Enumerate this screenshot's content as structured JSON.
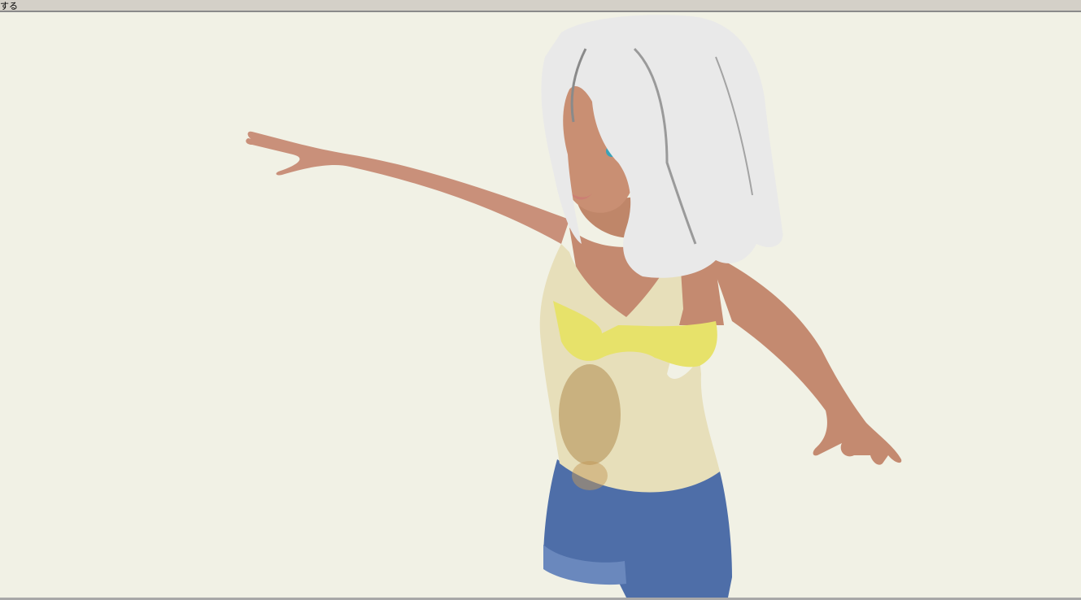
{
  "window": {
    "title_fragment": "する"
  },
  "colors": {
    "background": "#f1f1e5",
    "skin": "#c98e72",
    "hair": "#e6e6e6",
    "top": "#e6ddb6",
    "bra": "#e7e26a",
    "shorts": "#4d6ea6"
  }
}
